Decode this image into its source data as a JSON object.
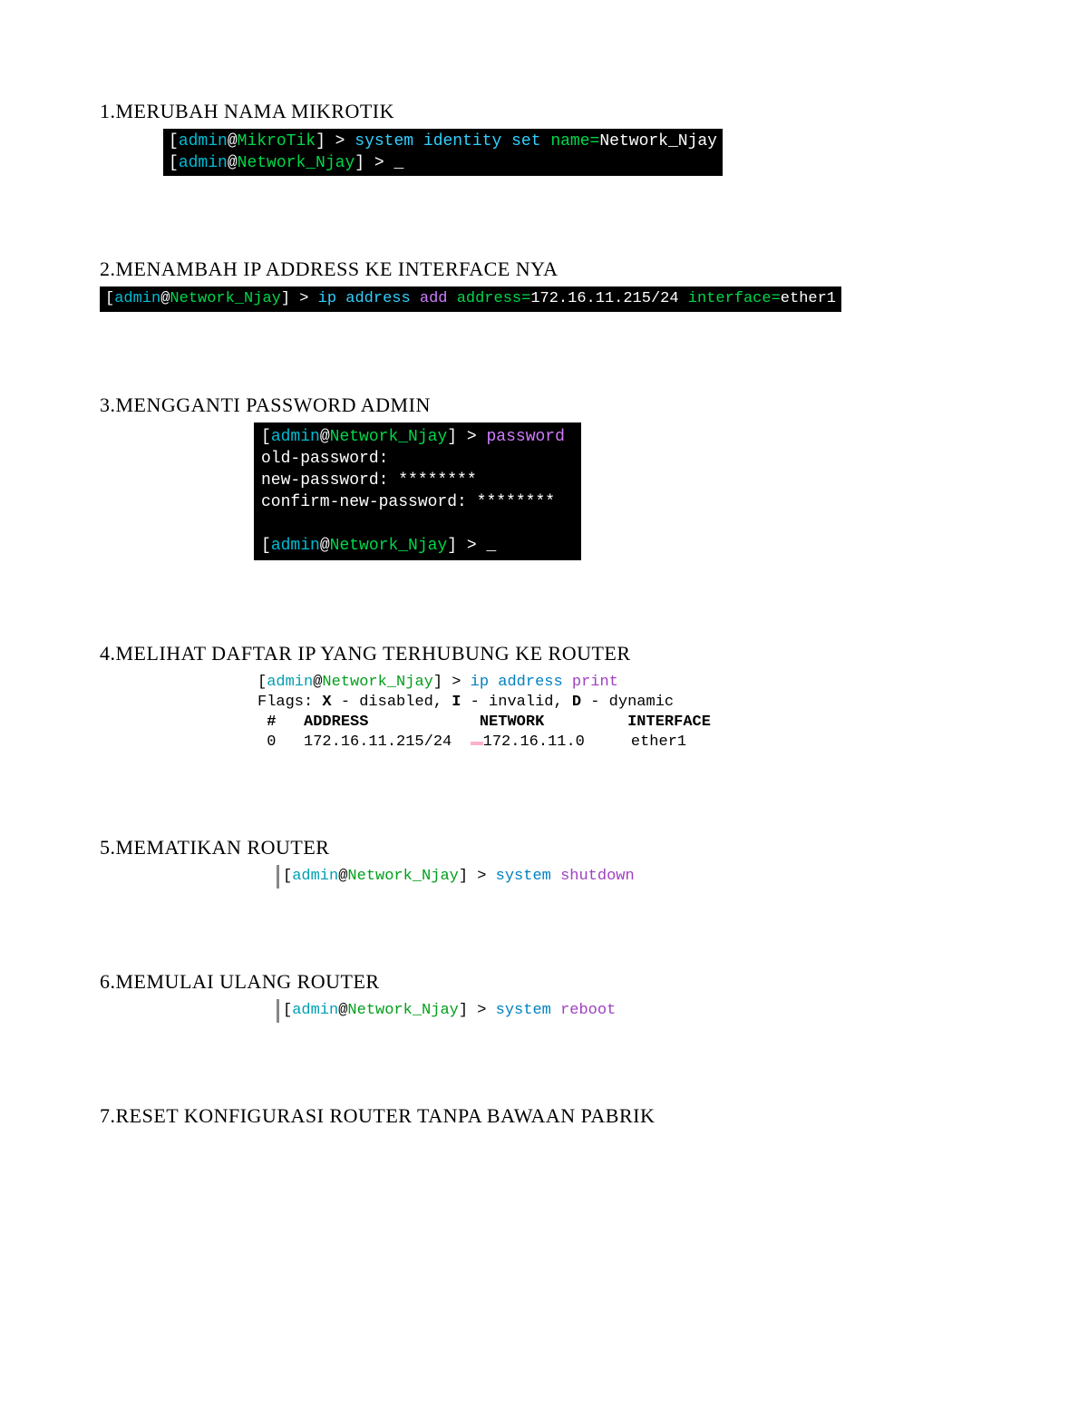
{
  "sections": {
    "s1": {
      "heading": "1.MERUBAH NAMA MIKROTIK",
      "line1_user": "admin",
      "line1_host": "MikroTik",
      "line1_cmd": "system identity set",
      "line1_kw": "name",
      "line1_val": "Network_Njay",
      "line2_user": "admin",
      "line2_host": "Network_Njay",
      "line2_cursor": "_"
    },
    "s2": {
      "heading": "2.MENAMBAH IP ADDRESS KE INTERFACE NYA",
      "user": "admin",
      "host": "Network_Njay",
      "cmd1": "ip address",
      "cmd2": "add",
      "kw1": "address",
      "ip": "172.16.11.215/24",
      "kw2": "interface",
      "val2": "ether1"
    },
    "s3": {
      "heading": "3.MENGGANTI PASSWORD ADMIN",
      "user": "admin",
      "host": "Network_Njay",
      "pw": "password",
      "old": "old-password:",
      "new": "new-password: ********",
      "confirm": "confirm-new-password: ********",
      "cursor": "_"
    },
    "s4": {
      "heading": "4.MELIHAT DAFTAR IP YANG TERHUBUNG KE ROUTER",
      "user": "admin",
      "host": "Network_Njay",
      "cmd1": "ip address",
      "cmd2": "print",
      "flags": "Flags: ",
      "flagX": "X",
      "flagXtxt": " - disabled, ",
      "flagI": "I",
      "flagItxt": " - invalid, ",
      "flagD": "D",
      "flagDtxt": " - dynamic",
      "hdr_num": " #   ",
      "hdr_addr": "ADDRESS",
      "hdr_net": "NETWORK",
      "hdr_if": "INTERFACE",
      "row_num": " 0   ",
      "row_addr": "172.16.11.215/24",
      "row_net": "172.16.11.0",
      "row_if": "ether1"
    },
    "s5": {
      "heading": "5.MEMATIKAN ROUTER",
      "user": "admin",
      "host": "Network_Njay",
      "cmd1": "system",
      "cmd2": "shutdown"
    },
    "s6": {
      "heading": "6.MEMULAI ULANG ROUTER",
      "user": "admin",
      "host": "Network_Njay",
      "cmd1": "system",
      "cmd2": "reboot"
    },
    "s7": {
      "heading": "7.RESET KONFIGURASI ROUTER TANPA BAWAAN PABRIK"
    }
  }
}
